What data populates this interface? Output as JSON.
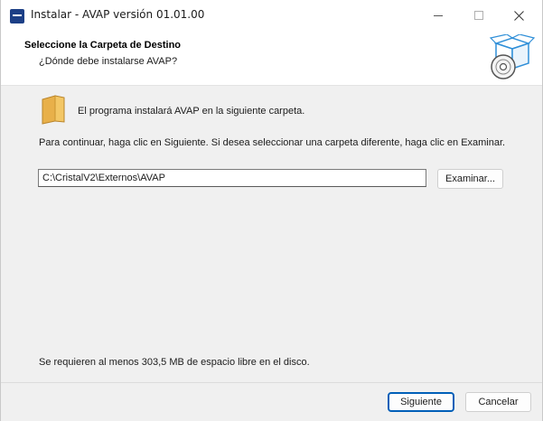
{
  "window": {
    "title": "Instalar - AVAP versión 01.01.00",
    "controls": [
      "minimize-icon",
      "maximize-icon",
      "close-icon"
    ]
  },
  "header": {
    "title": "Seleccione la Carpeta de Destino",
    "subtitle": "¿Dónde debe instalarse AVAP?",
    "icon": "install-box-disc-icon"
  },
  "body": {
    "folder_icon": "folder-icon",
    "info": "El programa instalará AVAP en la siguiente carpeta.",
    "instructions": "Para continuar, haga clic en Siguiente. Si desea seleccionar una carpeta diferente, haga clic en Examinar.",
    "path_value": "C:\\CristalV2\\Externos\\AVAP",
    "browse_label": "Examinar...",
    "space_required": "Se requieren al menos 303,5 MB de espacio libre en el disco."
  },
  "footer": {
    "next_label": "Siguiente",
    "cancel_label": "Cancelar"
  },
  "colors": {
    "accent": "#005fb8",
    "folder": "#e8b04a",
    "app_icon": "#1c3f86",
    "header_bg": "#ffffff",
    "body_bg": "#f0f0f0"
  }
}
